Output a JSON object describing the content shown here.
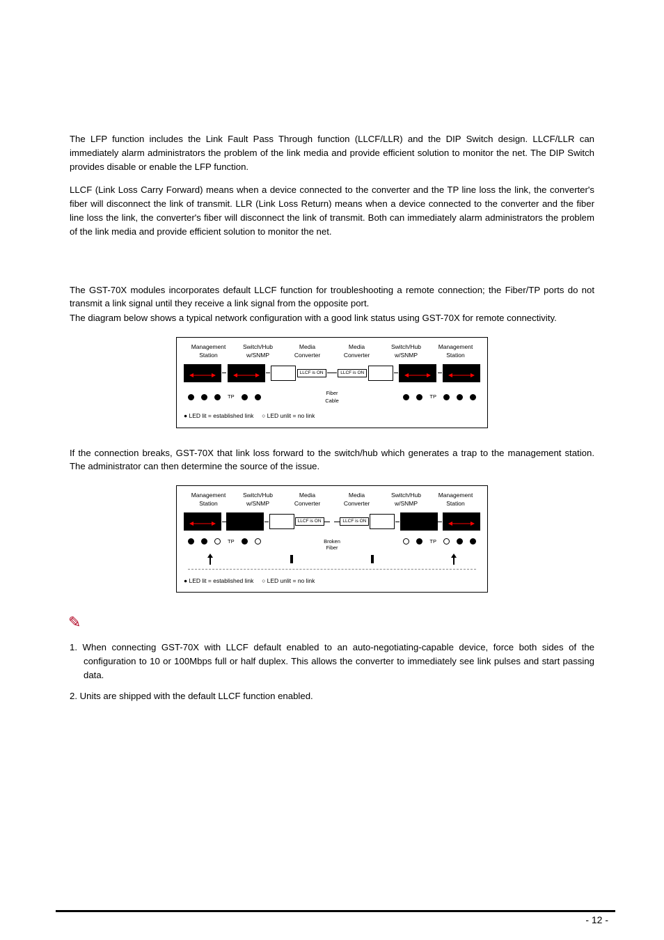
{
  "para1": "The LFP function includes the Link Fault Pass Through function (LLCF/LLR) and the DIP Switch design. LLCF/LLR can immediately alarm administrators the problem of the link media and provide efficient solution to monitor the net. The DIP Switch provides disable or enable the LFP function.",
  "para2": "LLCF (Link Loss Carry Forward) means when a device connected to the converter and the TP line loss the link, the converter's fiber will disconnect the link of transmit. LLR (Link Loss Return) means when a device connected to the converter and the fiber line loss the link, the converter's fiber will disconnect the link of transmit. Both can immediately alarm administrators the problem of the link media and provide efficient solution to monitor the net.",
  "para3": "The GST-70X modules incorporates default LLCF function for troubleshooting a remote connection; the Fiber/TP ports do not transmit a link signal until they receive a link signal from the opposite port.",
  "para4": "The diagram below shows a typical network configuration with a good link status using GST-70X for remote connectivity.",
  "para5": "If the connection breaks, GST-70X that link loss forward to the switch/hub which generates a trap to the management station. The administrator can then determine the source of the issue.",
  "diagram": {
    "cols": [
      {
        "l1": "Management",
        "l2": "Station"
      },
      {
        "l1": "Switch/Hub",
        "l2": "w/SNMP"
      },
      {
        "l1": "Media",
        "l2": "Converter"
      },
      {
        "l1": "Media",
        "l2": "Converter"
      },
      {
        "l1": "Switch/Hub",
        "l2": "w/SNMP"
      },
      {
        "l1": "Management",
        "l2": "Station"
      }
    ],
    "llcf_label": "LLCF is ON",
    "tp_label": "TP",
    "fiber_cable": "Fiber",
    "cable": "Cable",
    "broken": "Broken",
    "fiber": "Fiber",
    "legend_lit": "● LED lit = established link",
    "legend_unlit": "○ LED unlit = no link"
  },
  "notes": {
    "n1": "1. When connecting GST-70X with LLCF default enabled to an auto-negotiating-capable device, force both sides of the configuration to 10 or 100Mbps full or half duplex. This allows the converter to immediately see link pulses and start passing data.",
    "n2": "2. Units are shipped with the default LLCF function enabled."
  },
  "page": "- 12 -"
}
